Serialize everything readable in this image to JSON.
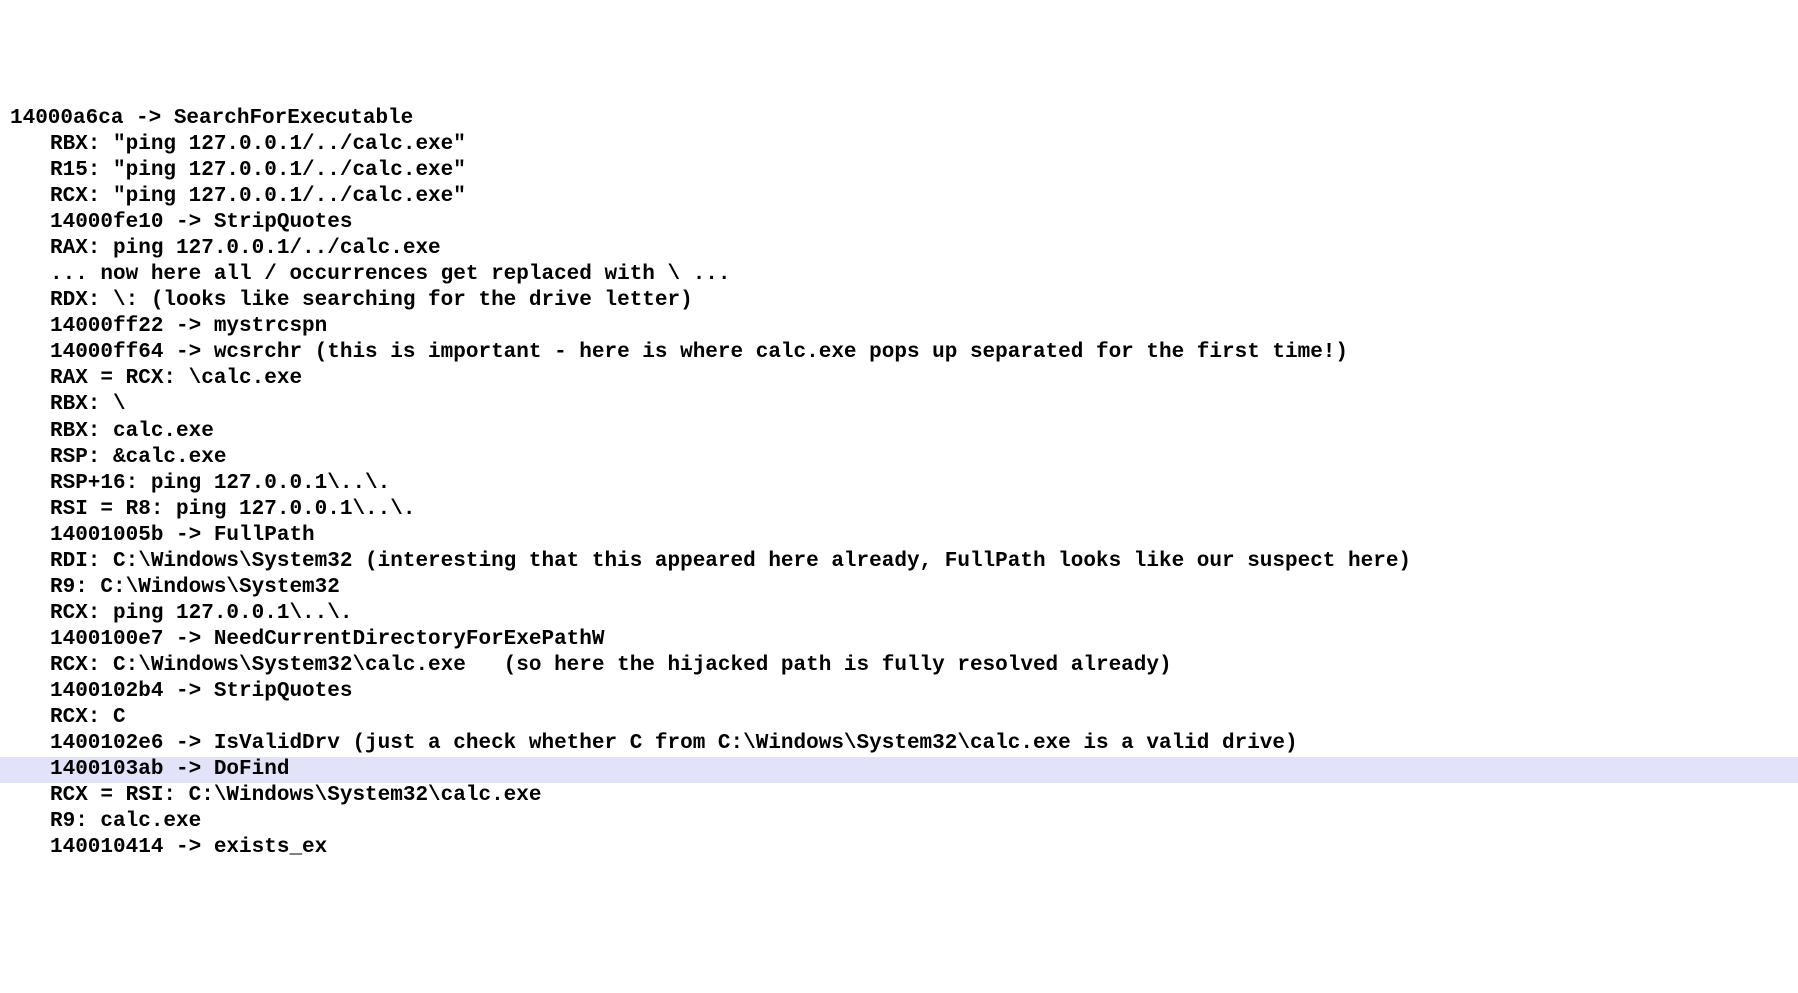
{
  "lines": [
    {
      "indent": false,
      "highlight": false,
      "text": "14000a6ca -> SearchForExecutable"
    },
    {
      "indent": true,
      "highlight": false,
      "text": "RBX: \"ping 127.0.0.1/../calc.exe\""
    },
    {
      "indent": true,
      "highlight": false,
      "text": "R15: \"ping 127.0.0.1/../calc.exe\""
    },
    {
      "indent": true,
      "highlight": false,
      "text": "RCX: \"ping 127.0.0.1/../calc.exe\""
    },
    {
      "indent": true,
      "highlight": false,
      "text": "14000fe10 -> StripQuotes"
    },
    {
      "indent": true,
      "highlight": false,
      "text": "RAX: ping 127.0.0.1/../calc.exe"
    },
    {
      "indent": true,
      "highlight": false,
      "text": "... now here all / occurrences get replaced with \\ ..."
    },
    {
      "indent": true,
      "highlight": false,
      "text": "RDX: \\: (looks like searching for the drive letter)"
    },
    {
      "indent": true,
      "highlight": false,
      "text": "14000ff22 -> mystrcspn"
    },
    {
      "indent": true,
      "highlight": false,
      "text": "14000ff64 -> wcsrchr (this is important - here is where calc.exe pops up separated for the first time!)"
    },
    {
      "indent": true,
      "highlight": false,
      "text": "RAX = RCX: \\calc.exe"
    },
    {
      "indent": true,
      "highlight": false,
      "text": "RBX: \\"
    },
    {
      "indent": true,
      "highlight": false,
      "text": "RBX: calc.exe"
    },
    {
      "indent": true,
      "highlight": false,
      "text": "RSP: &calc.exe"
    },
    {
      "indent": true,
      "highlight": false,
      "text": "RSP+16: ping 127.0.0.1\\..\\."
    },
    {
      "indent": true,
      "highlight": false,
      "text": "RSI = R8: ping 127.0.0.1\\..\\."
    },
    {
      "indent": true,
      "highlight": false,
      "text": "14001005b -> FullPath"
    },
    {
      "indent": true,
      "highlight": false,
      "text": "RDI: C:\\Windows\\System32 (interesting that this appeared here already, FullPath looks like our suspect here)"
    },
    {
      "indent": true,
      "highlight": false,
      "text": "R9: C:\\Windows\\System32"
    },
    {
      "indent": true,
      "highlight": false,
      "text": "RCX: ping 127.0.0.1\\..\\."
    },
    {
      "indent": true,
      "highlight": false,
      "text": "1400100e7 -> NeedCurrentDirectoryForExePathW"
    },
    {
      "indent": true,
      "highlight": false,
      "text": "RCX: C:\\Windows\\System32\\calc.exe   (so here the hijacked path is fully resolved already)"
    },
    {
      "indent": true,
      "highlight": false,
      "text": "1400102b4 -> StripQuotes"
    },
    {
      "indent": true,
      "highlight": false,
      "text": "RCX: C"
    },
    {
      "indent": true,
      "highlight": false,
      "text": "1400102e6 -> IsValidDrv (just a check whether C from C:\\Windows\\System32\\calc.exe is a valid drive)"
    },
    {
      "indent": true,
      "highlight": true,
      "text": "1400103ab -> DoFind"
    },
    {
      "indent": true,
      "highlight": false,
      "text": "RCX = RSI: C:\\Windows\\System32\\calc.exe"
    },
    {
      "indent": true,
      "highlight": false,
      "text": "R9: calc.exe"
    },
    {
      "indent": true,
      "highlight": false,
      "text": "140010414 -> exists_ex"
    }
  ]
}
